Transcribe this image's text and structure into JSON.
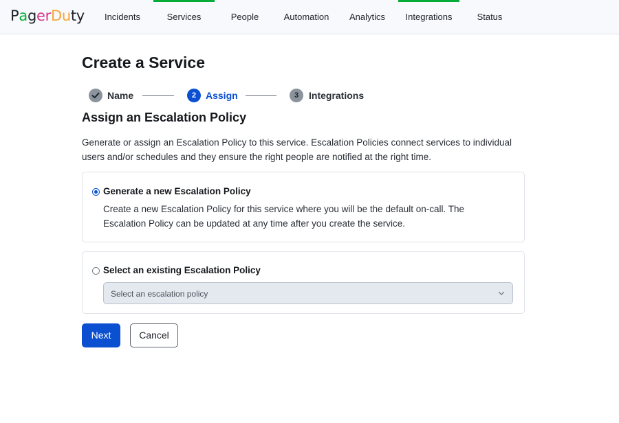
{
  "app": {
    "logo_text": "PagerDuty",
    "logo_letters": [
      {
        "ch": "P",
        "color": "#1f2329"
      },
      {
        "ch": "a",
        "color": "#06ac38"
      },
      {
        "ch": "g",
        "color": "#1f2329"
      },
      {
        "ch": "e",
        "color": "#d9328a"
      },
      {
        "ch": "r",
        "color": "#d9328a"
      },
      {
        "ch": "D",
        "color": "#f6a53b"
      },
      {
        "ch": "u",
        "color": "#f6a53b"
      },
      {
        "ch": "t",
        "color": "#1f2329"
      },
      {
        "ch": "y",
        "color": "#1f2329"
      }
    ]
  },
  "nav": {
    "items": [
      {
        "label": "Incidents",
        "active": false
      },
      {
        "label": "Services",
        "active": true
      },
      {
        "label": "People",
        "active": false
      },
      {
        "label": "Automation",
        "active": false
      },
      {
        "label": "Analytics",
        "active": false
      },
      {
        "label": "Integrations",
        "active": true
      },
      {
        "label": "Status",
        "active": false
      }
    ],
    "accent_color": "#06ac38"
  },
  "page": {
    "title": "Create a Service"
  },
  "stepper": {
    "steps": [
      {
        "marker": "check-icon",
        "label": "Name",
        "state": "complete"
      },
      {
        "marker": "2",
        "label": "Assign",
        "state": "current"
      },
      {
        "marker": "3",
        "label": "Integrations",
        "state": "upcoming"
      }
    ],
    "colors": {
      "complete_bg": "#8b939c",
      "current_bg": "#0b50d0",
      "upcoming_bg": "#8b939c",
      "current_text": "#0b50d0",
      "label_text": "#2a2f36"
    }
  },
  "section": {
    "title": "Assign an Escalation Policy",
    "intro": "Generate or assign an Escalation Policy to this service. Escalation Policies connect services to individual users and/or schedules and they ensure the right people are notified at the right time."
  },
  "options": {
    "generate": {
      "label": "Generate a new Escalation Policy",
      "description": "Create a new Escalation Policy for this service where you will be the default on-call. The Escalation Policy can be updated at any time after you create the service.",
      "selected": true
    },
    "existing": {
      "label": "Select an existing Escalation Policy",
      "selected": false,
      "select_placeholder": "Select an escalation policy"
    }
  },
  "actions": {
    "next_label": "Next",
    "cancel_label": "Cancel",
    "primary_color": "#0b50d0"
  }
}
